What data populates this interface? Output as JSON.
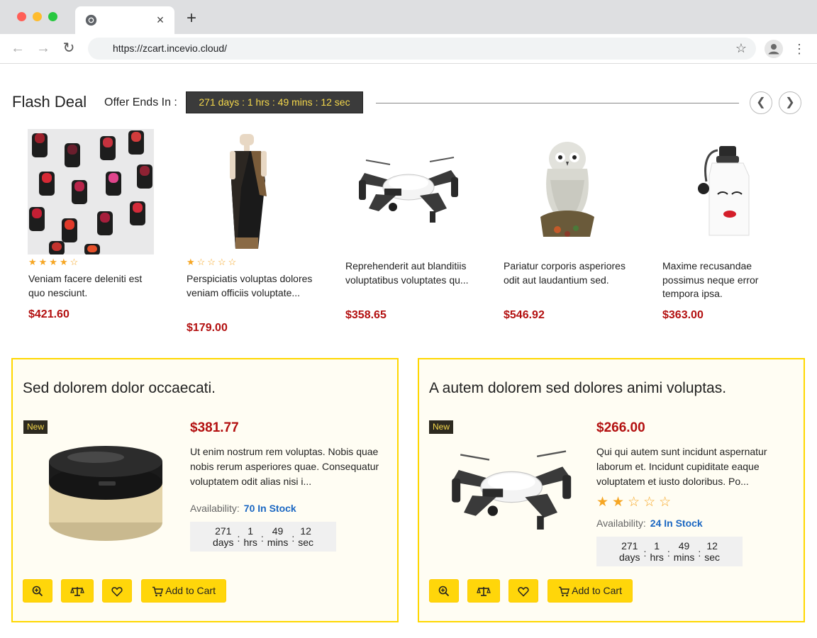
{
  "browser": {
    "url": "https://zcart.incevio.cloud/",
    "new_tab_symbol": "+",
    "tab_close_symbol": "×"
  },
  "flash_deal": {
    "title": "Flash Deal",
    "offer_label": "Offer Ends In :",
    "timer": "271 days : 1 hrs : 49 mins : 12 sec",
    "products": [
      {
        "name": "Veniam facere deleniti est quo nesciunt.",
        "price": "$421.60",
        "rating": 4,
        "image": "lipsticks-image"
      },
      {
        "name": "Perspiciatis voluptas dolores veniam officiis voluptate...",
        "price": "$179.00",
        "rating": 1,
        "image": "saree-image"
      },
      {
        "name": "Reprehenderit aut blanditiis voluptatibus voluptates qu...",
        "price": "$358.65",
        "rating": null,
        "image": "drone-image"
      },
      {
        "name": "Pariatur corporis asperiores odit aut laudantium sed.",
        "price": "$546.92",
        "rating": null,
        "image": "owl-figurine-image"
      },
      {
        "name": "Maxime recusandae possimus neque error tempora ipsa.",
        "price": "$363.00",
        "rating": null,
        "image": "water-bottle-image"
      }
    ]
  },
  "deals": [
    {
      "title": "Sed dolorem dolor occaecati.",
      "badge": "New",
      "price": "$381.77",
      "description": "Ut enim nostrum rem voluptas. Nobis quae nobis rerum asperiores quae. Consequatur voluptatem odit alias nisi i...",
      "rating": null,
      "availability_label": "Availability:",
      "availability_value": "70 In Stock",
      "countdown": {
        "days": "271",
        "days_label": "days",
        "hrs": "1",
        "hrs_label": "hrs",
        "mins": "49",
        "mins_label": "mins",
        "sec": "12",
        "sec_label": "sec"
      },
      "add_to_cart_label": "Add to Cart",
      "image": "powder-compact-image"
    },
    {
      "title": "A autem dolorem sed dolores animi voluptas.",
      "badge": "New",
      "price": "$266.00",
      "description": "Qui qui autem sunt incidunt aspernatur laborum et. Incidunt cupiditate eaque voluptatem et iusto doloribus. Po...",
      "rating": 2,
      "availability_label": "Availability:",
      "availability_value": "24 In Stock",
      "countdown": {
        "days": "271",
        "days_label": "days",
        "hrs": "1",
        "hrs_label": "hrs",
        "mins": "49",
        "mins_label": "mins",
        "sec": "12",
        "sec_label": "sec"
      },
      "add_to_cart_label": "Add to Cart",
      "image": "drone-image"
    }
  ],
  "colors": {
    "price": "#b31010",
    "star": "#f6a623",
    "accent_yellow": "#ffd60a",
    "stock_blue": "#1b67c2",
    "timer_text": "#f5d84b"
  }
}
